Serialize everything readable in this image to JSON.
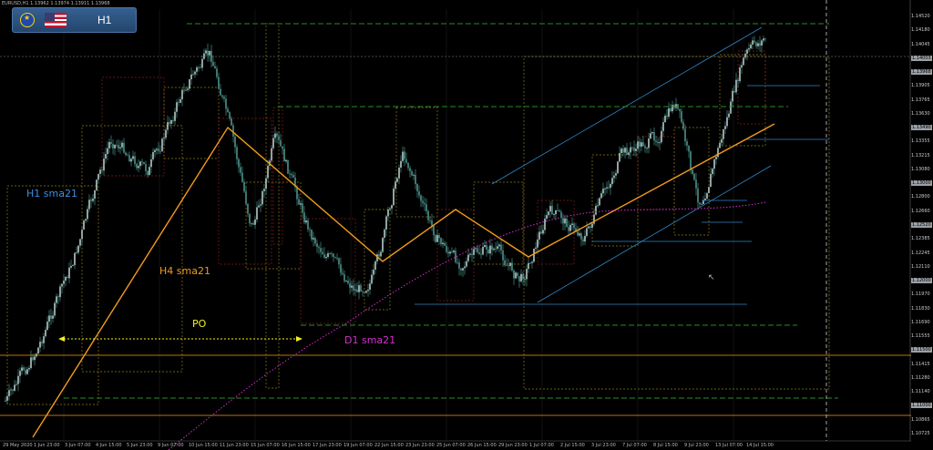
{
  "symbol_header": "EURUSD,H1  1.13962 1.13974 1.13911 1.13968",
  "badge": {
    "timeframe": "H1"
  },
  "labels": {
    "h1_sma": "H1 sma21",
    "h4_sma": "H4 sma21",
    "d1_sma": "D1 sma21",
    "po": "PO"
  },
  "colors": {
    "h1_sma": "#3d8fe0",
    "h4_sma": "#f29b1c",
    "d1_sma": "#d62fd0",
    "po": "#f3f021",
    "candle": "#57a7a0",
    "level_green": "#2a8a2a",
    "channel_blue": "#2f86c8",
    "trend_orange": "#f29b1c"
  },
  "price_axis": [
    {
      "value": "1.14520",
      "hl": false
    },
    {
      "value": "1.14180",
      "hl": false
    },
    {
      "value": "1.14045",
      "hl": false
    },
    {
      "value": "1.14003",
      "hl": true
    },
    {
      "value": "1.13968",
      "hl": true
    },
    {
      "value": "1.13905",
      "hl": false
    },
    {
      "value": "1.13765",
      "hl": false
    },
    {
      "value": "1.13630",
      "hl": false
    },
    {
      "value": "1.13490",
      "hl": true
    },
    {
      "value": "1.13355",
      "hl": false
    },
    {
      "value": "1.13215",
      "hl": false
    },
    {
      "value": "1.13080",
      "hl": false
    },
    {
      "value": "1.13000",
      "hl": true
    },
    {
      "value": "1.12800",
      "hl": false
    },
    {
      "value": "1.12660",
      "hl": false
    },
    {
      "value": "1.12520",
      "hl": true
    },
    {
      "value": "1.12385",
      "hl": false
    },
    {
      "value": "1.12245",
      "hl": false
    },
    {
      "value": "1.12110",
      "hl": false
    },
    {
      "value": "1.12000",
      "hl": true
    },
    {
      "value": "1.11970",
      "hl": false
    },
    {
      "value": "1.11830",
      "hl": false
    },
    {
      "value": "1.11690",
      "hl": false
    },
    {
      "value": "1.11555",
      "hl": false
    },
    {
      "value": "1.11500",
      "hl": true
    },
    {
      "value": "1.11415",
      "hl": false
    },
    {
      "value": "1.11280",
      "hl": false
    },
    {
      "value": "1.11140",
      "hl": false
    },
    {
      "value": "1.11000",
      "hl": true
    },
    {
      "value": "1.10865",
      "hl": false
    },
    {
      "value": "1.10725",
      "hl": false
    }
  ],
  "time_axis": [
    "29 May 2020",
    "1 Jun 23:00",
    "3 Jun 07:00",
    "4 Jun 15:00",
    "5 Jun 23:00",
    "9 Jun 07:00",
    "10 Jun 15:00",
    "11 Jun 23:00",
    "15 Jun 07:00",
    "16 Jun 15:00",
    "17 Jun 23:00",
    "19 Jun 07:00",
    "22 Jun 15:00",
    "23 Jun 23:00",
    "25 Jun 07:00",
    "26 Jun 15:00",
    "29 Jun 23:00",
    "1 Jul 07:00",
    "2 Jul 15:00",
    "3 Jul 23:00",
    "7 Jul 07:00",
    "8 Jul 15:00",
    "9 Jul 23:00",
    "13 Jul 07:00",
    "14 Jul 15:00"
  ]
}
